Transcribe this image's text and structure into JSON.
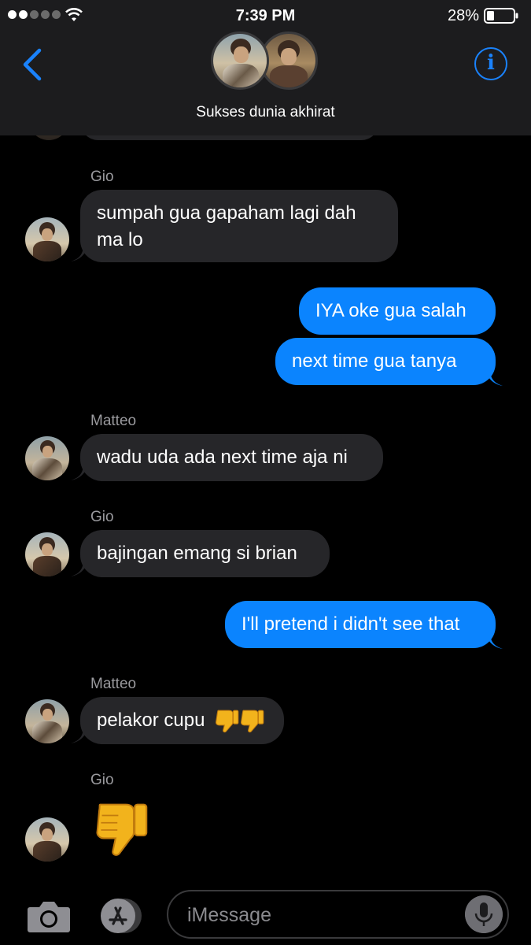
{
  "status_bar": {
    "time": "7:39 PM",
    "battery": "28%",
    "signal_bars_on": 2,
    "signal_bars_total": 5
  },
  "header": {
    "group_name": "Sukses dunia akhirat",
    "back_icon": "chevron-left-icon",
    "info_icon": "info-icon",
    "info_glyph": "i"
  },
  "colors": {
    "accent": "#1a82fb",
    "outgoing_bubble": "#0b84fe",
    "incoming_bubble": "#262629",
    "header_bg": "#1c1c1e"
  },
  "messages": [
    {
      "sender": "Gio",
      "direction": "in",
      "text_line1": "sumpah gua gapaham lagi dah",
      "text_line2": "ma lo"
    },
    {
      "direction": "out",
      "text": "IYA oke gua salah"
    },
    {
      "direction": "out",
      "text": "next time gua tanya"
    },
    {
      "sender": "Matteo",
      "direction": "in",
      "text": "wadu uda ada next time aja ni"
    },
    {
      "sender": "Gio",
      "direction": "in",
      "text": "bajingan emang si brian"
    },
    {
      "direction": "out",
      "text": "I'll pretend i didn't see that"
    },
    {
      "sender": "Matteo",
      "direction": "in",
      "text": "pelakor cupu",
      "emoji": "thumbs-down-icon x2"
    },
    {
      "sender": "Gio",
      "direction": "in",
      "emoji": "thumbs-down-icon"
    }
  ],
  "input": {
    "placeholder": "iMessage",
    "camera_icon": "camera-icon",
    "apps_icon": "app-store-icon",
    "mic_icon": "microphone-icon"
  }
}
